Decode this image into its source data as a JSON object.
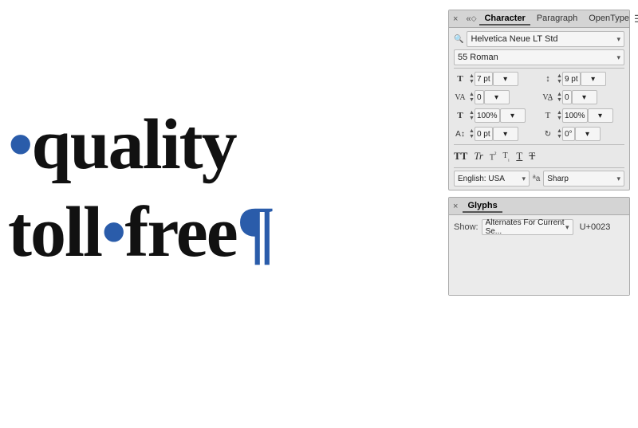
{
  "canvas": {
    "background": "#ffffff",
    "text_quality": "•quality",
    "text_toll": "toll•free¶"
  },
  "character_panel": {
    "title": "Character",
    "close_icon": "×",
    "tabs": [
      {
        "label": "Character",
        "active": true
      },
      {
        "label": "Paragraph",
        "active": false
      },
      {
        "label": "OpenType",
        "active": false
      }
    ],
    "font_family": "Helvetica Neue LT Std",
    "font_style": "55 Roman",
    "params": {
      "size_label": "T",
      "size_value": "7 pt",
      "leading_value": "9 pt",
      "kerning_value": "0",
      "tracking_value": "0",
      "scale_h_value": "100%",
      "scale_v_value": "100%",
      "baseline_value": "0 pt",
      "rotation_value": "0°"
    },
    "type_buttons": [
      "TT",
      "Tr",
      "T²",
      "T₁",
      "T̲",
      "T̄"
    ],
    "language": "English: USA",
    "aa_label": "ªa",
    "aa_value": "Sharp"
  },
  "glyphs_panel": {
    "title": "Glyphs",
    "close_icon": "×",
    "show_label": "Show:",
    "show_value": "Alternates For Current Se...",
    "unicode_value": "U+0023"
  }
}
